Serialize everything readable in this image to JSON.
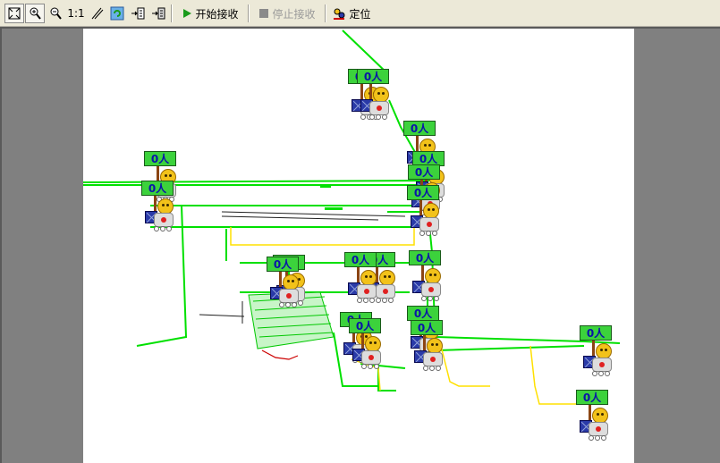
{
  "toolbar": {
    "one_to_one_label": "1:1",
    "start_receive_label": "开始接收",
    "stop_receive_label": "停止接收",
    "locate_label": "定位",
    "start_icon_color": "#1a9a1a",
    "stop_icon_color": "#8a8a8a"
  },
  "map": {
    "background": "#ffffff",
    "line_colors": {
      "main": "#00e000",
      "secondary": "#ffe000",
      "accent": "#cc0000",
      "dark": "#202020"
    },
    "markers": [
      {
        "label": "0人"
      },
      {
        "label": "0人"
      },
      {
        "label": "0人"
      },
      {
        "label": "0人"
      },
      {
        "label": "0人"
      },
      {
        "label": "0人"
      },
      {
        "label": "0人"
      },
      {
        "label": "0人"
      },
      {
        "label": "0人"
      },
      {
        "label": "0人"
      },
      {
        "label": "0人"
      },
      {
        "label": "0人"
      },
      {
        "label": "0人"
      },
      {
        "label": "0人"
      },
      {
        "label": "0人"
      },
      {
        "label": "0人"
      },
      {
        "label": "0人"
      },
      {
        "label": "0人"
      },
      {
        "label": "0人"
      }
    ]
  }
}
